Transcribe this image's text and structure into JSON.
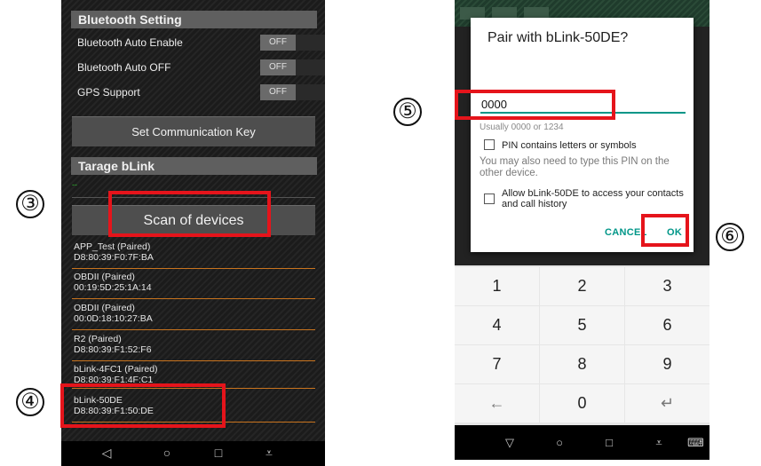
{
  "left": {
    "bluetooth_section": "Bluetooth Setting",
    "settings": [
      {
        "label": "Bluetooth Auto Enable",
        "toggle": "OFF"
      },
      {
        "label": "Bluetooth Auto OFF",
        "toggle": "OFF"
      },
      {
        "label": "GPS Support",
        "toggle": "OFF"
      }
    ],
    "set_key_button": "Set Communication Key",
    "tarage_section": "Tarage bLink",
    "status_text": "--",
    "scan_button": "Scan of devices",
    "devices": [
      {
        "name": "APP_Test (Paired)",
        "mac": "D8:80:39:F0:7F:BA"
      },
      {
        "name": "OBDII (Paired)",
        "mac": "00:19:5D:25:1A:14"
      },
      {
        "name": "OBDII (Paired)",
        "mac": "00:0D:18:10:27:BA"
      },
      {
        "name": "R2 (Paired)",
        "mac": "D8:80:39:F1:52:F6"
      },
      {
        "name": "bLink-4FC1 (Paired)",
        "mac": "D8:80:39:F1:4F:C1"
      },
      {
        "name": "bLink-50DE",
        "mac": "D8:80:39:F1:50:DE"
      }
    ],
    "nav": {
      "back": "◁",
      "home": "○",
      "recents": "□",
      "menu": "⩡"
    }
  },
  "right": {
    "dialog_title": "Pair with bLink-50DE?",
    "pin_value": "0000",
    "pin_hint": "Usually 0000 or 1234",
    "checkbox_letters": "PIN contains letters or symbols",
    "info_text": "You may also need to type this PIN on the other device.",
    "checkbox_contacts": "Allow bLink-50DE to access your contacts and call history",
    "cancel": "CANCEL",
    "ok": "OK",
    "keys": [
      "1",
      "2",
      "3",
      "4",
      "5",
      "6",
      "7",
      "8",
      "9",
      "←",
      "0",
      "↵"
    ],
    "nav": {
      "back": "▽",
      "home": "○",
      "recents": "□",
      "menu": "⩡",
      "keyboard": "⌨"
    }
  },
  "annotations": {
    "step3": "③",
    "step4": "④",
    "step5": "⑤",
    "step6": "⑥"
  },
  "colors": {
    "accent": "#009688",
    "highlight": "#e5141b",
    "divider": "#c9741e"
  }
}
